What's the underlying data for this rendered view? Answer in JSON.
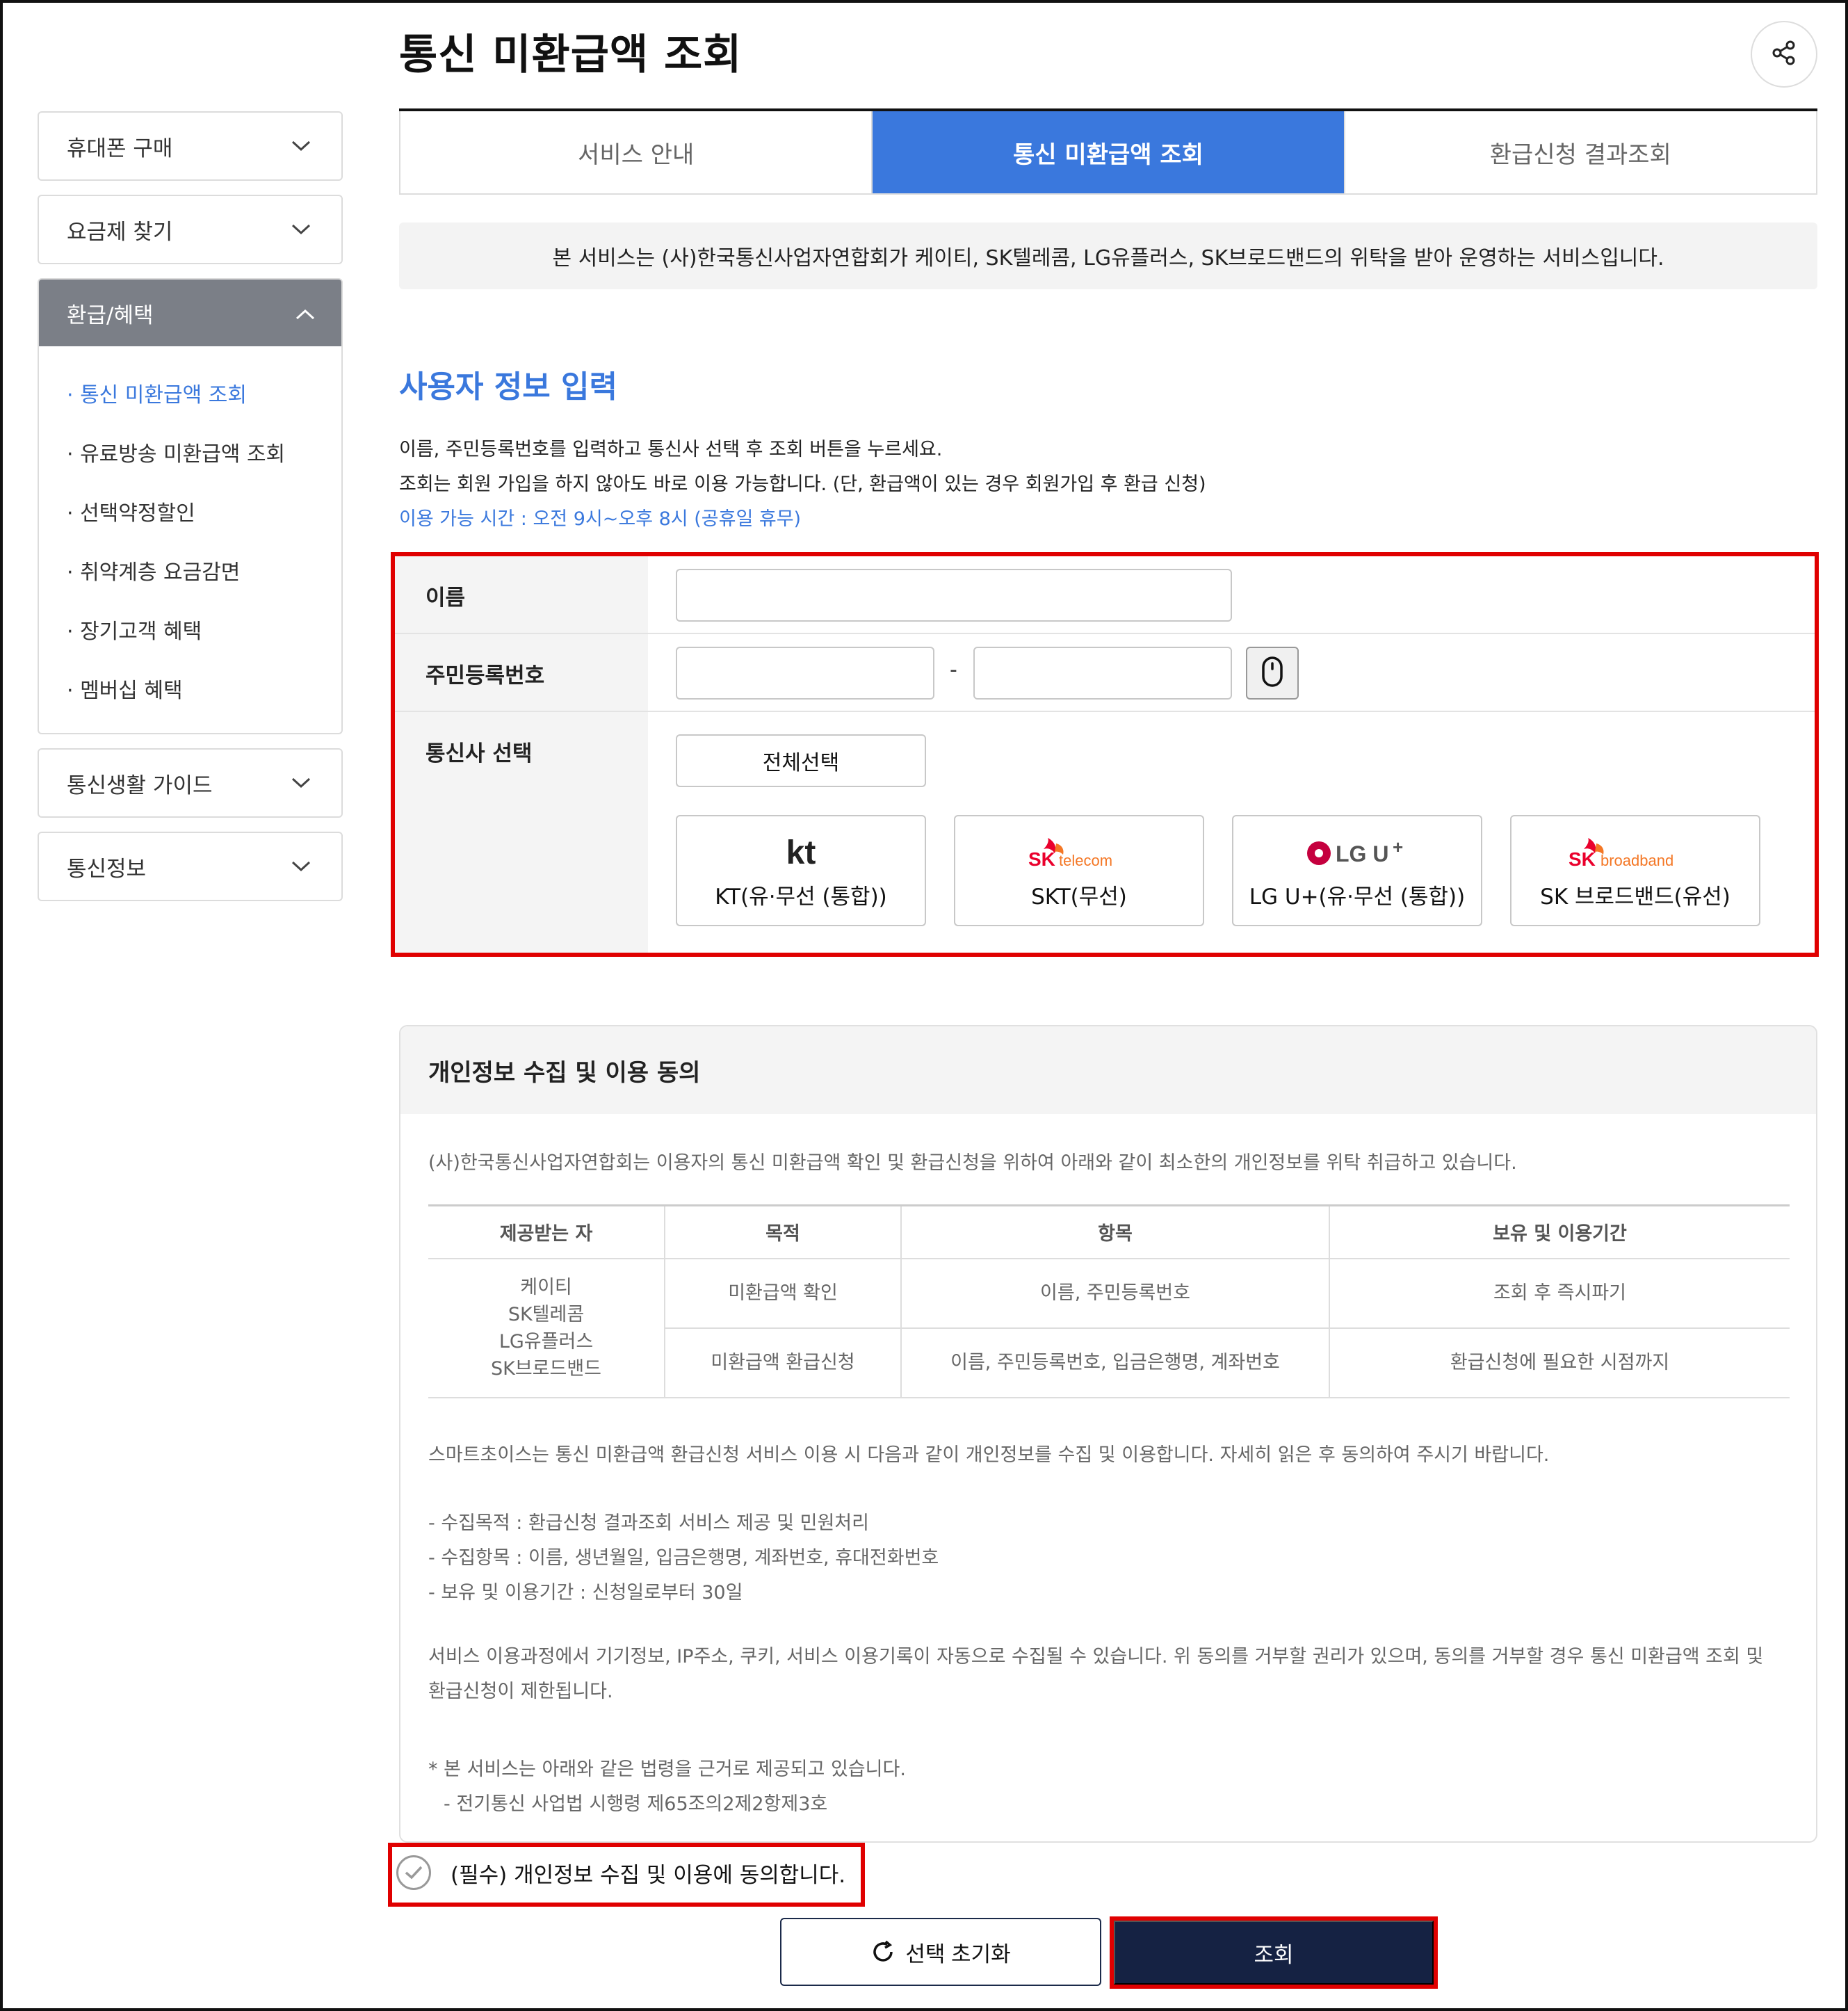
{
  "page_title": "통신 미환급액 조회",
  "sidebar": {
    "items": [
      {
        "label": "휴대폰 구매"
      },
      {
        "label": "요금제 찾기"
      }
    ],
    "open_group": {
      "label": "환급/혜택",
      "children": [
        {
          "label": "· 통신 미환급액 조회",
          "active": true
        },
        {
          "label": "· 유료방송 미환급액 조회"
        },
        {
          "label": "· 선택약정할인"
        },
        {
          "label": "· 취약계층 요금감면"
        },
        {
          "label": "· 장기고객 혜택"
        },
        {
          "label": "· 멤버십 혜택"
        }
      ]
    },
    "bottom_items": [
      {
        "label": "통신생활 가이드"
      },
      {
        "label": "통신정보"
      }
    ]
  },
  "tabs": [
    {
      "label": "서비스 안내"
    },
    {
      "label": "통신 미환급액 조회",
      "active": true
    },
    {
      "label": "환급신청 결과조회"
    }
  ],
  "notice": "본 서비스는 (사)한국통신사업자연합회가 케이티, SK텔레콤, LG유플러스, SK브로드밴드의 위탁을 받아 운영하는 서비스입니다.",
  "section_title": "사용자 정보 입력",
  "description": {
    "line1": "이름, 주민등록번호를 입력하고 통신사 선택 후 조회 버튼을 누르세요.",
    "line2": "조회는 회원 가입을 하지 않아도 바로 이용 가능합니다. (단, 환급액이 있는 경우 회원가입 후 환급 신청)",
    "hours": "이용 가능 시간 : 오전 9시~오후 8시 (공휴일 휴무)"
  },
  "form": {
    "name_label": "이름",
    "name_value": "",
    "rrn_label": "주민등록번호",
    "rrn_first_value": "",
    "rrn_second_value": "",
    "rrn_separator": "-",
    "carrier_label": "통신사 선택",
    "select_all": "전체선택",
    "carriers": [
      {
        "logo_text": "kt",
        "name": "KT(유·무선 (통합))"
      },
      {
        "logo_text": "SK telecom",
        "name": "SKT(무선)"
      },
      {
        "logo_text": "LG U+",
        "name": "LG U+(유·무선 (통합))"
      },
      {
        "logo_text": "SK broadband",
        "name": "SK 브로드밴드(유선)"
      }
    ]
  },
  "consent": {
    "title": "개인정보 수집 및 이용 동의",
    "intro": "(사)한국통신사업자연합회는 이용자의 통신 미환급액 확인 및 환급신청을 위하여 아래와 같이 최소한의 개인정보를 위탁 취급하고 있습니다.",
    "table": {
      "headers": [
        "제공받는 자",
        "목적",
        "항목",
        "보유 및 이용기간"
      ],
      "recipients": [
        "케이티",
        "SK텔레콤",
        "LG유플러스",
        "SK브로드밴드"
      ],
      "rows": [
        [
          "미환급액 확인",
          "이름, 주민등록번호",
          "조회 후 즉시파기"
        ],
        [
          "미환급액 환급신청",
          "이름, 주민등록번호, 입금은행명, 계좌번호",
          "환급신청에 필요한 시점까지"
        ]
      ]
    },
    "para1": "스마트초이스는 통신 미환급액 환급신청 서비스 이용 시 다음과 같이 개인정보를 수집 및 이용합니다. 자세히 읽은 후 동의하여 주시기 바랍니다.",
    "items": [
      "- 수집목적 : 환급신청 결과조회 서비스 제공 및 민원처리",
      "- 수집항목 : 이름, 생년월일, 입금은행명, 계좌번호, 휴대전화번호",
      "- 보유 및 이용기간 : 신청일로부터 30일"
    ],
    "para2_line1": "서비스 이용과정에서 기기정보, IP주소, 쿠키, 서비스 이용기록이 자동으로 수집될 수 있습니다. 위 동의를 거부할 권리가 있으며, 동의를 거부할 경우 통신 미환급액 조회 및",
    "para2_line2": "환급신청이 제한됩니다.",
    "law_title": "* 본 서비스는 아래와 같은 법령을 근거로 제공되고 있습니다.",
    "law_item": "- 전기통신 사업법 시행령 제65조의2제2항제3호"
  },
  "agreement": "(필수) 개인정보 수집 및 이용에 동의합니다.",
  "buttons": {
    "reset": "선택 초기화",
    "search": "조회"
  },
  "colors": {
    "accent_blue": "#3a78dd",
    "navy": "#152243",
    "highlight_red": "#e00000",
    "sidebar_active_bg": "#7b7f87"
  }
}
